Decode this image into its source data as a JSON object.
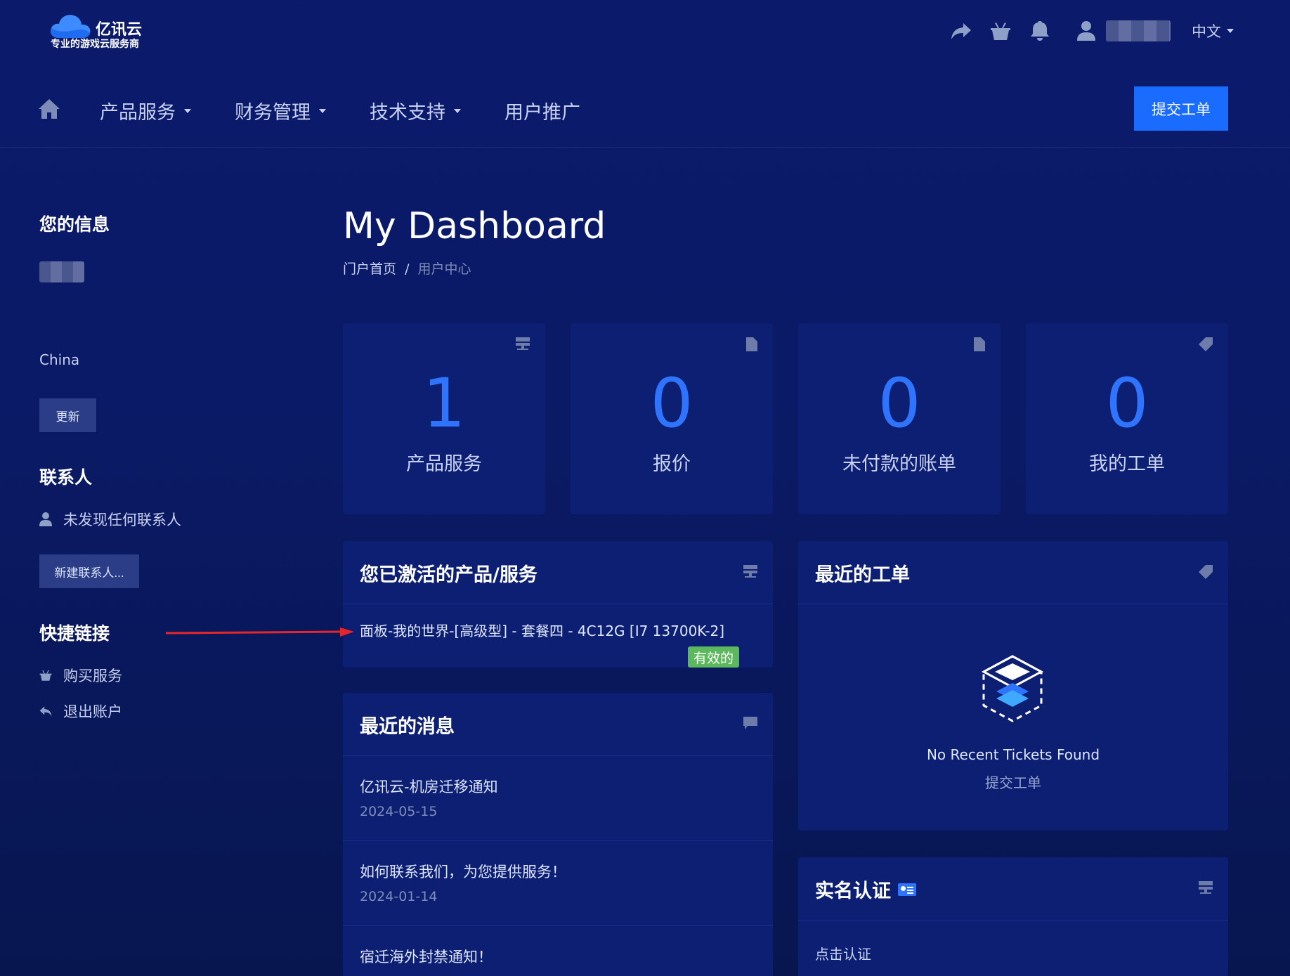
{
  "header": {
    "logo": {
      "brand": "亿讯云",
      "slogan": "专业的游戏云服务商"
    },
    "icons": [
      "share-icon",
      "basket-icon",
      "bell-icon",
      "user-icon"
    ],
    "language": "中文"
  },
  "nav": {
    "items": [
      {
        "label": "产品服务",
        "has_dropdown": true
      },
      {
        "label": "财务管理",
        "has_dropdown": true
      },
      {
        "label": "技术支持",
        "has_dropdown": true
      },
      {
        "label": "用户推广",
        "has_dropdown": false
      }
    ],
    "submit_ticket": "提交工单"
  },
  "sidebar": {
    "info_title": "您的信息",
    "country": "China",
    "update_button": "更新",
    "contacts_title": "联系人",
    "no_contacts": "未发现任何联系人",
    "new_contact_button": "新建联系人...",
    "shortcuts_title": "快捷链接",
    "shortcuts": [
      {
        "label": "购买服务",
        "icon": "basket-icon"
      },
      {
        "label": "退出账户",
        "icon": "reply-icon"
      }
    ]
  },
  "main": {
    "title": "My Dashboard",
    "breadcrumb": {
      "home": "门户首页",
      "separator": "/",
      "current": "用户中心"
    }
  },
  "stats": [
    {
      "value": "1",
      "label": "产品服务",
      "icon": "server-icon"
    },
    {
      "value": "0",
      "label": "报价",
      "icon": "document-icon"
    },
    {
      "value": "0",
      "label": "未付款的账单",
      "icon": "document-icon"
    },
    {
      "value": "0",
      "label": "我的工单",
      "icon": "tag-icon"
    }
  ],
  "active_services": {
    "title": "您已激活的产品/服务",
    "service_name": "面板-我的世界-[高级型] - 套餐四 - 4C12G [I7 13700K-2]",
    "status": "有效的"
  },
  "recent_news": {
    "title": "最近的消息",
    "items": [
      {
        "title": "亿讯云-机房迁移通知",
        "date": "2024-05-15"
      },
      {
        "title": "如何联系我们，为您提供服务！",
        "date": "2024-01-14"
      },
      {
        "title": "宿迁海外封禁通知！",
        "date": ""
      }
    ]
  },
  "recent_tickets": {
    "title": "最近的工单",
    "empty_text": "No Recent Tickets Found",
    "submit_link": "提交工单"
  },
  "verification": {
    "title": "实名认证",
    "link": "点击认证"
  },
  "colors": {
    "background": "#0a1a66",
    "card": "#0c1f72",
    "accent": "#1a6bff",
    "stat_number": "#2f74ff",
    "success": "#5cb85c",
    "annotation_arrow": "#e8262a"
  }
}
